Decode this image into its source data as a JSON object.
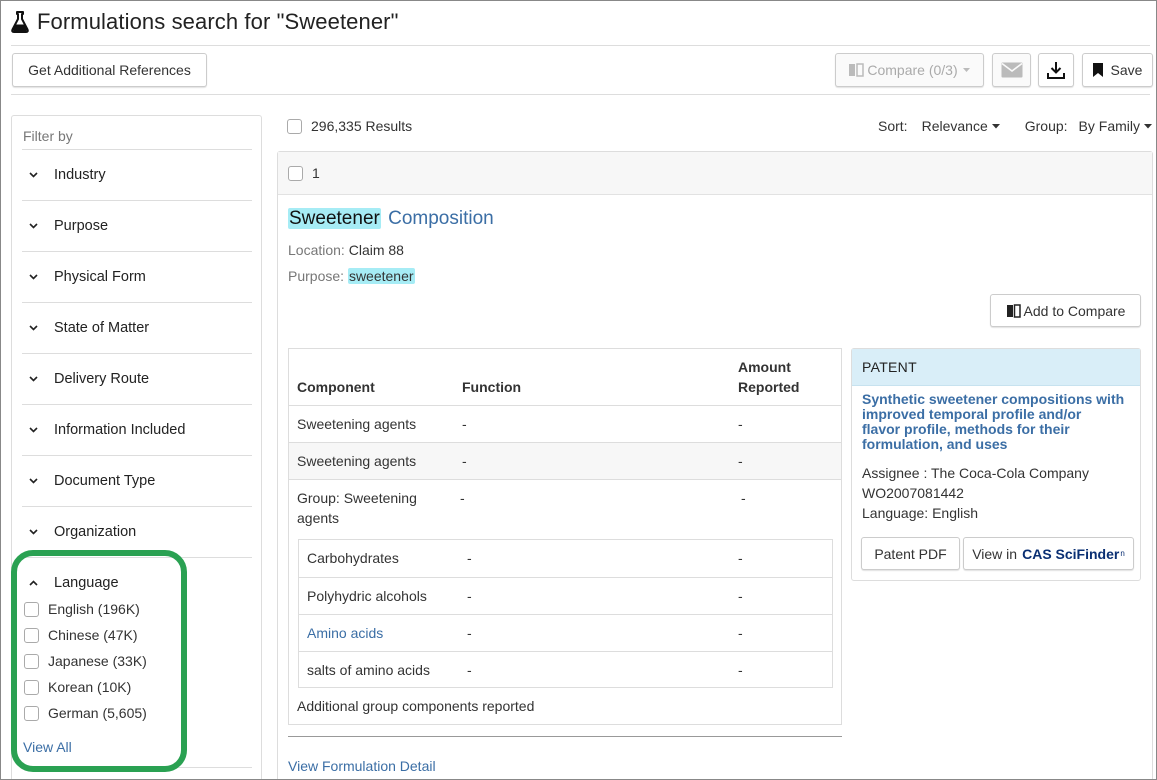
{
  "header": {
    "title": "Formulations search for \"Sweetener\"",
    "icon": "flask-icon"
  },
  "toolbar": {
    "get_refs_label": "Get Additional References",
    "compare_label": "Compare (0/3)",
    "save_label": "Save"
  },
  "sidebar": {
    "filter_by": "Filter by",
    "facets": [
      "Industry",
      "Purpose",
      "Physical Form",
      "State of Matter",
      "Delivery Route",
      "Information Included",
      "Document Type",
      "Organization"
    ],
    "language": {
      "label": "Language",
      "items": [
        "English (196K)",
        "Chinese (47K)",
        "Japanese (33K)",
        "Korean (10K)",
        "German (5,605)"
      ],
      "view_all": "View All"
    }
  },
  "results": {
    "count": "296,335 Results",
    "sort_label": "Sort:",
    "sort_value": "Relevance",
    "group_label": "Group:",
    "group_value": "By Family"
  },
  "card": {
    "index": "1",
    "title_highlight": "Sweetener",
    "title_rest": "Composition",
    "location_label": "Location:",
    "location_value": "Claim 88",
    "purpose_label": "Purpose:",
    "purpose_value": "sweetener",
    "add_compare": "Add to Compare",
    "table": {
      "headers": [
        "Component",
        "Function",
        "Amount",
        "Reported"
      ],
      "rows": [
        [
          "Sweetening agents",
          "-",
          "-"
        ],
        [
          "Sweetening agents",
          "-",
          "-"
        ]
      ],
      "group_line1": "Group: Sweetening",
      "group_line2": "agents",
      "group_function": "-",
      "group_amount": "-",
      "sub_rows": [
        [
          "Carbohydrates",
          "-",
          "-"
        ],
        [
          "Polyhydric alcohols",
          "-",
          "-"
        ],
        [
          "Amino acids",
          "-",
          "-"
        ],
        [
          "salts of amino acids",
          "-",
          "-"
        ]
      ],
      "additional": "Additional group components reported"
    },
    "view_detail": "View Formulation Detail",
    "patent": {
      "heading": "PATENT",
      "title_lines": [
        "Synthetic sweetener compositions with",
        "improved temporal profile and/or",
        "flavor profile, methods for their",
        "formulation, and uses"
      ],
      "assignee": "Assignee : The Coca-Cola Company",
      "number": "WO2007081442",
      "language": "Language: English",
      "pdf_label": "Patent PDF",
      "view_in": "View in",
      "scifinder": "CAS SciFinder",
      "scifinder_sup": "n"
    }
  },
  "colors": {
    "highlight": "#a6ecf5",
    "link": "#3b6ea5",
    "callout": "#2aa152",
    "patent_header": "#d9eef8"
  }
}
